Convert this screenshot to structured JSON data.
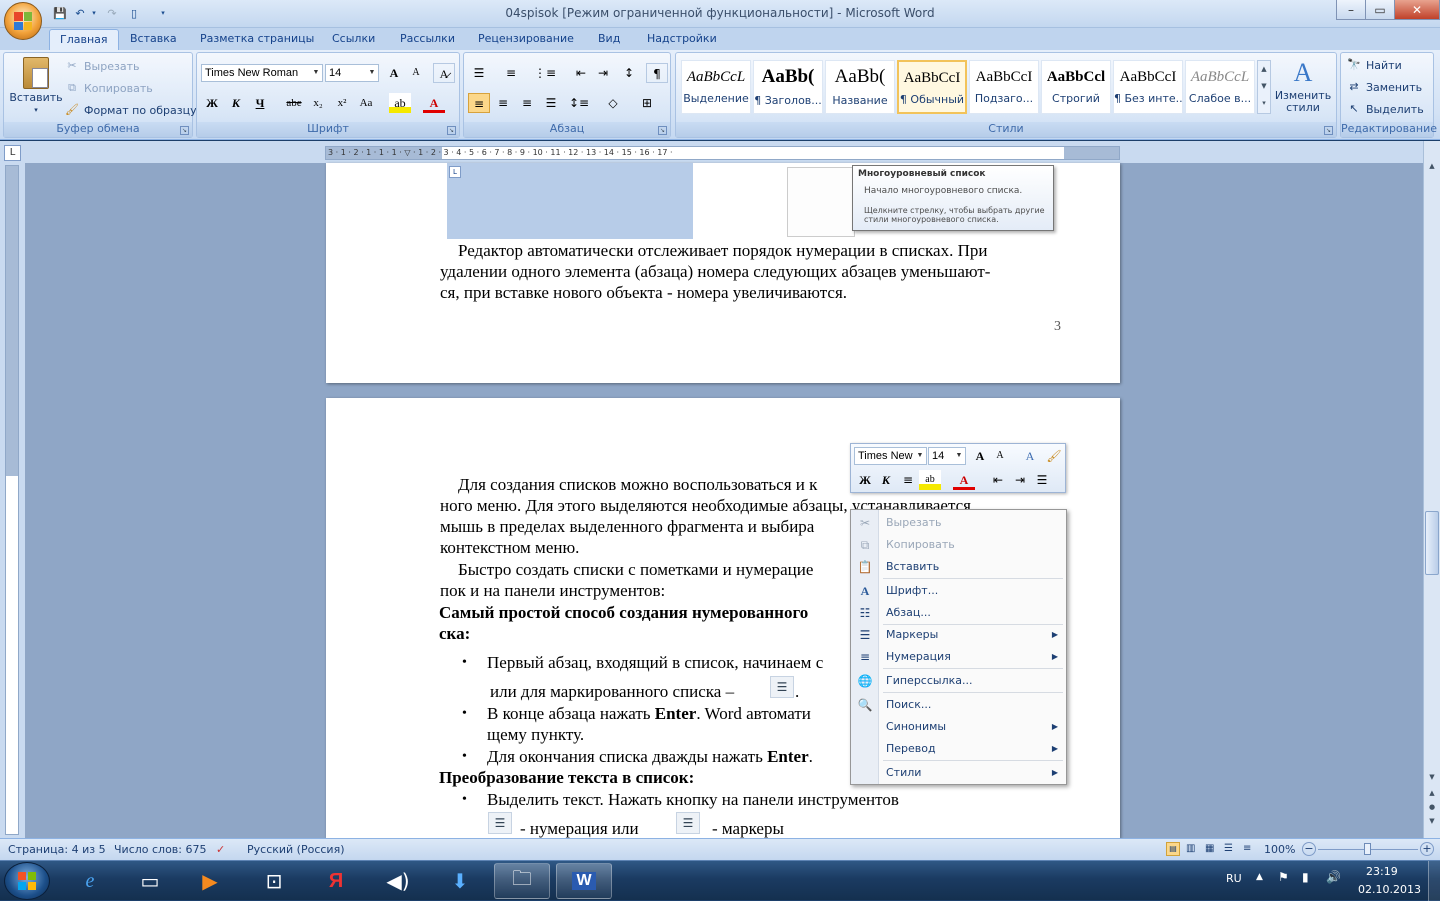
{
  "window": {
    "title": "04spisok [Режим ограниченной функциональности] - Microsoft Word",
    "controls": {
      "minimize": "–",
      "maximize": "▭",
      "close": "✕"
    }
  },
  "tabs": [
    "Главная",
    "Вставка",
    "Разметка страницы",
    "Ссылки",
    "Рассылки",
    "Рецензирование",
    "Вид",
    "Надстройки"
  ],
  "active_tab": "Главная",
  "ribbon": {
    "clipboard": {
      "label": "Буфер обмена",
      "paste": "Вставить",
      "cut": "Вырезать",
      "copy": "Копировать",
      "format_painter": "Формат по образцу"
    },
    "font": {
      "label": "Шрифт",
      "font_name": "Times New Roman",
      "font_size": "14",
      "bold": "Ж",
      "italic": "К",
      "underline": "Ч",
      "strike": "abe",
      "subscript": "x₂",
      "superscript": "x²",
      "change_case": "Aa",
      "grow": "A",
      "shrink": "A"
    },
    "paragraph": {
      "label": "Абзац"
    },
    "styles": {
      "label": "Стили",
      "items": [
        {
          "preview": "AaBbCcL",
          "name": "Выделение"
        },
        {
          "preview": "AaBb(",
          "name": "¶ Заголов..."
        },
        {
          "preview": "AaBb(",
          "name": "Название"
        },
        {
          "preview": "AaBbCcI",
          "name": "¶ Обычный"
        },
        {
          "preview": "AaBbCcI",
          "name": "Подзаго..."
        },
        {
          "preview": "AaBbCcl",
          "name": "Строгий"
        },
        {
          "preview": "AaBbCcI",
          "name": "¶ Без инте..."
        },
        {
          "preview": "AaBbCcL",
          "name": "Слабое в..."
        }
      ],
      "change_styles": "Изменить стили"
    },
    "editing": {
      "label": "Редактирование",
      "find": "Найти",
      "replace": "Заменить",
      "select": "Выделить"
    }
  },
  "ruler": {
    "ticks": "3 · 1 · 2 · 1 · 1 · 1 · ▽ · 1 · 2 · 3 · 4 · 5 · 6 · 7 · 8 · 9 · 10 · 11 · 12 · 13 · 14 · 15 · 16 · 17 ·"
  },
  "tooltip": {
    "title": "Многоуровневый список",
    "line1": "Начало многоуровневого списка.",
    "line2": "Щелкните стрелку, чтобы выбрать другие",
    "line3": "стили многоуровневого списка."
  },
  "page1": {
    "lines": [
      "Редактор автоматически отслеживает порядок нумерации в списках. При",
      "удалении одного элемента (абзаца) номера следующих абзацев уменьшают-",
      "ся, при вставке нового объекта - номера увеличиваются."
    ],
    "page_number": "3"
  },
  "page2": {
    "p1": [
      "Для создания списков можно воспользоваться и к",
      "ного меню. Для этого выделяются необходимые абзацы, устанавливается",
      "мышь в пределах выделенного фрагмента и выбира",
      "контекстном меню."
    ],
    "p2": [
      "Быстро создать списки с пометками и нумерацие",
      "пок и на панели инструментов:"
    ],
    "heading1": [
      "Самый простой способ создания нумерованного",
      "ска:"
    ],
    "b1a": "Первый абзац, входящий в список, начинаем с",
    "b1b_pre": "или  для маркированного списка –",
    "b1b_post": ".",
    "b2_pre": "В конце абзаца нажать ",
    "b2_bold": "Enter",
    "b2_post": ". Word автомати",
    "b2b": "щему пункту.",
    "b3_pre": "Для окончания списка дважды нажать ",
    "b3_bold": "Enter",
    "b3_post": ".",
    "heading2": "Преобразование текста в список:",
    "b4": "Выделить текст. Нажать кнопку на панели инструментов",
    "b4b_num": "- нумерация  или",
    "b4b_mark": "- маркеры"
  },
  "mini_toolbar": {
    "font": "Times New",
    "size": "14"
  },
  "context_menu": {
    "items": [
      {
        "label": "Вырезать",
        "icon": "scissors-icon",
        "disabled": true
      },
      {
        "label": "Копировать",
        "icon": "copy-icon",
        "disabled": true
      },
      {
        "label": "Вставить",
        "icon": "paste-icon",
        "disabled": false
      },
      {
        "label": "Шрифт...",
        "icon": "font-icon",
        "disabled": false
      },
      {
        "label": "Абзац...",
        "icon": "paragraph-icon",
        "disabled": false
      },
      {
        "label": "Маркеры",
        "icon": "bullets-icon",
        "disabled": false,
        "submenu": true
      },
      {
        "label": "Нумерация",
        "icon": "numbering-icon",
        "disabled": false,
        "submenu": true
      },
      {
        "label": "Гиперссылка...",
        "icon": "hyperlink-icon",
        "disabled": false
      },
      {
        "label": "Поиск...",
        "icon": "research-icon",
        "disabled": false
      },
      {
        "label": "Синонимы",
        "icon": "",
        "disabled": false,
        "submenu": true
      },
      {
        "label": "Перевод",
        "icon": "",
        "disabled": false,
        "submenu": true
      },
      {
        "label": "Стили",
        "icon": "",
        "disabled": false,
        "submenu": true
      }
    ]
  },
  "status": {
    "page": "Страница: 4 из 5",
    "words": "Число слов: 675",
    "language": "Русский (Россия)",
    "zoom": "100%"
  },
  "taskbar": {
    "lang": "RU",
    "time": "23:19",
    "date": "02.10.2013"
  },
  "colors": {
    "accent": "#15428b",
    "titlebar": "#c3d7ef",
    "taskbar": "#1b3b62"
  }
}
